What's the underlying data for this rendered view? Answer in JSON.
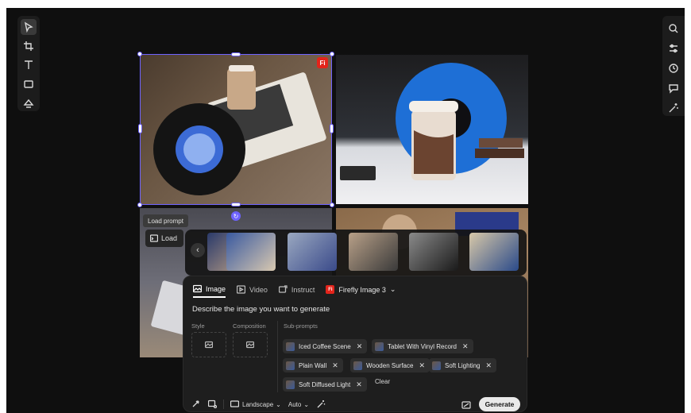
{
  "canvas": {
    "ff_badge": "Fi"
  },
  "load": {
    "tooltip": "Load prompt",
    "button_label": "Load"
  },
  "panel": {
    "tabs": [
      {
        "label": "Image",
        "icon": "image-icon",
        "active": true
      },
      {
        "label": "Video",
        "icon": "video-icon",
        "active": false
      },
      {
        "label": "Instruct",
        "icon": "instruct-icon",
        "active": false
      }
    ],
    "model": {
      "badge": "Fi",
      "label": "Firefly Image 3"
    },
    "prompt_placeholder": "Describe the image you want to generate",
    "style_label": "Style",
    "composition_label": "Composition",
    "subprompts_label": "Sub-prompts",
    "subprompts": [
      "Iced Coffee Scene",
      "Tablet With Vinyl Record",
      "Plain Wall",
      "Wooden Surface",
      "Soft Lighting",
      "Soft Diffused Light"
    ],
    "clear_label": "Clear",
    "aspect": "Landscape",
    "size_mode": "Auto",
    "generate_label": "Generate"
  },
  "colors": {
    "accent": "#6e63ff",
    "firefly_red": "#e3241b",
    "panel_bg": "#1e1e1e"
  }
}
